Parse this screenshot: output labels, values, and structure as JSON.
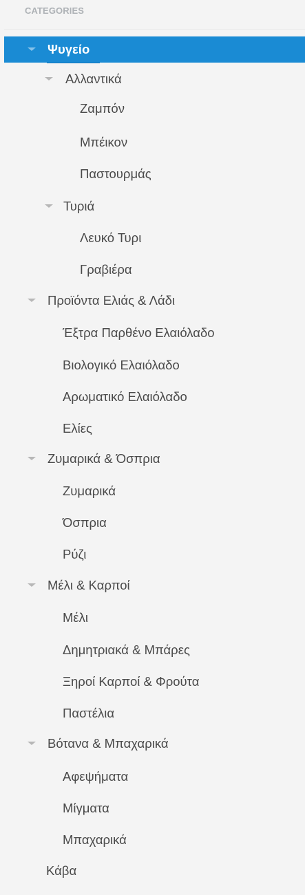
{
  "heading": "CATEGORIES",
  "tree": [
    {
      "label": "Ψυγείο",
      "expanded": true,
      "active": true
    },
    {
      "label": "Αλλαντικά",
      "expanded": true
    },
    {
      "label": "Ζαμπόν"
    },
    {
      "label": "Μπέικον"
    },
    {
      "label": "Παστουρμάς"
    },
    {
      "label": "Τυριά",
      "expanded": true
    },
    {
      "label": "Λευκό Τυρι"
    },
    {
      "label": "Γραβιέρα"
    },
    {
      "label": "Προϊόντα Ελιάς & Λάδι",
      "expanded": true
    },
    {
      "label": "Έξτρα Παρθένο Ελαιόλαδο"
    },
    {
      "label": "Βιολογικό Ελαιόλαδο"
    },
    {
      "label": "Αρωματικό Ελαιόλαδο"
    },
    {
      "label": "Ελίες"
    },
    {
      "label": "Ζυμαρικά & Όσπρια",
      "expanded": true
    },
    {
      "label": "Ζυμαρικά"
    },
    {
      "label": "Όσπρια"
    },
    {
      "label": "Ρύζι"
    },
    {
      "label": "Μέλι & Καρποί",
      "expanded": true
    },
    {
      "label": "Μέλι"
    },
    {
      "label": "Δημητριακά & Μπάρες"
    },
    {
      "label": "Ξηροί Καρποί & Φρούτα"
    },
    {
      "label": "Παστέλια"
    },
    {
      "label": "Βότανα & Μπαχαρικά",
      "expanded": true
    },
    {
      "label": "Αφεψήματα"
    },
    {
      "label": "Μίγματα"
    },
    {
      "label": "Μπαχαρικά"
    },
    {
      "label": "Κάβα"
    }
  ]
}
